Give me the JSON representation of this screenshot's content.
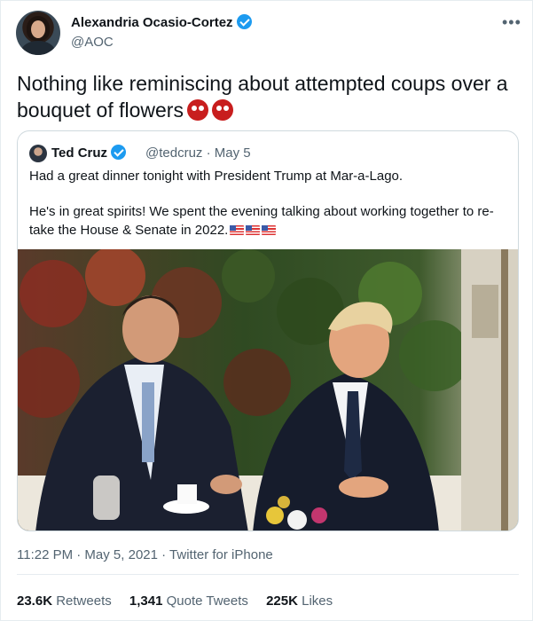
{
  "author": {
    "name": "Alexandria Ocasio-Cortez",
    "handle": "@AOC",
    "verified_icon": "verified-badge-icon"
  },
  "tweet": {
    "text": "Nothing like reminiscing about attempted coups over a bouquet of flowers",
    "emoji": "japanese-ogre-emoji"
  },
  "quoted": {
    "name": "Ted Cruz",
    "handle": "@tedcruz",
    "date": "· May 5",
    "line1": "Had a great dinner tonight with President Trump at Mar-a-Lago.",
    "line2": "He's in great spirits! We spent the evening talking about working together to re-take the House & Senate in 2022.",
    "flags": "us-flag-emoji"
  },
  "meta": {
    "timestamp": "11:22 PM · May 5, 2021 · Twitter for iPhone"
  },
  "stats": {
    "retweets_count": "23.6K",
    "retweets_label": "Retweets",
    "quotes_count": "1,341",
    "quotes_label": "Quote Tweets",
    "likes_count": "225K",
    "likes_label": "Likes"
  },
  "colors": {
    "accent": "#1d9bf0",
    "secondary_text": "#536471",
    "border": "#cfd9de"
  }
}
